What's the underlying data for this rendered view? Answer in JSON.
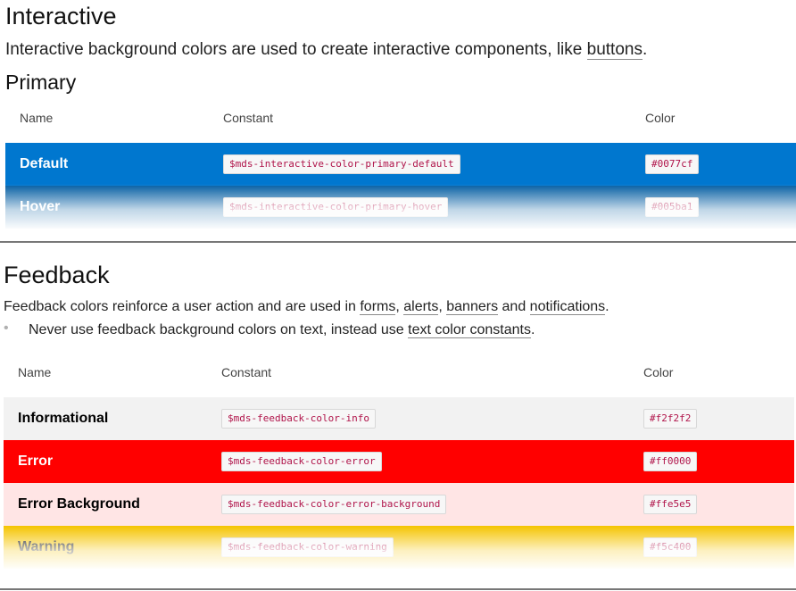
{
  "interactive": {
    "title": "Interactive",
    "intro_text": "Interactive background colors are used to create interactive components, like ",
    "intro_link": "buttons",
    "intro_end": ".",
    "subtitle": "Primary",
    "headers": {
      "name": "Name",
      "constant": "Constant",
      "color": "Color"
    },
    "rows": [
      {
        "name": "Default",
        "constant": "$mds-interactive-color-primary-default",
        "color": "#0077cf",
        "bg": "#0077cf",
        "fg": "#ffffff"
      },
      {
        "name": "Hover",
        "constant": "$mds-interactive-color-primary-hover",
        "color": "#005ba1",
        "bg": "#005ba1",
        "fg": "#ffffff"
      }
    ]
  },
  "feedback": {
    "title": "Feedback",
    "intro_text": "Feedback colors reinforce a user action and are used in ",
    "links": [
      "forms",
      "alerts",
      "banners",
      "notifications"
    ],
    "sep_comma": ", ",
    "sep_and": " and ",
    "intro_end": ".",
    "bullet_text": "Never use feedback background colors on text, instead use ",
    "bullet_link": "text color constants",
    "bullet_end": ".",
    "bullet_symbol": "•",
    "headers": {
      "name": "Name",
      "constant": "Constant",
      "color": "Color"
    },
    "rows": [
      {
        "name": "Informational",
        "constant": "$mds-feedback-color-info",
        "color": "#f2f2f2",
        "bg": "#f2f2f2",
        "fg": "#000000"
      },
      {
        "name": "Error",
        "constant": "$mds-feedback-color-error",
        "color": "#ff0000",
        "bg": "#ff0000",
        "fg": "#ffffff"
      },
      {
        "name": "Error Background",
        "constant": "$mds-feedback-color-error-background",
        "color": "#ffe5e5",
        "bg": "#ffe5e5",
        "fg": "#000000"
      },
      {
        "name": "Warning",
        "constant": "$mds-feedback-color-warning",
        "color": "#f5c400",
        "bg": "#f5c400",
        "fg": "#000000"
      }
    ]
  }
}
